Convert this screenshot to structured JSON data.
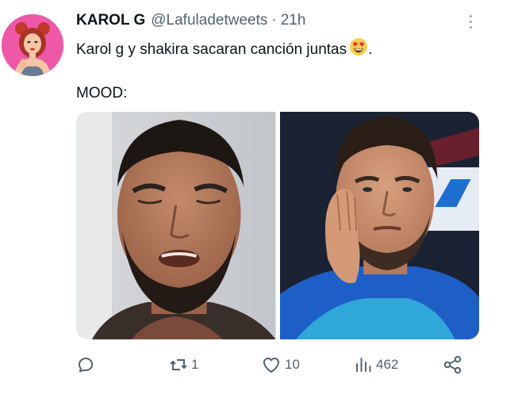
{
  "tweet": {
    "author_name": "KAROL G",
    "handle": "@Lafuladetweets",
    "separator": "·",
    "time": "21h",
    "text_line1": "Karol g y shakira sacaran canción juntas",
    "emoji": "smiling-face-with-heart-eyes",
    "text_line1_end": ".",
    "text_line2": "MOOD:"
  },
  "media": {
    "images": [
      {
        "name": "man-crying-face-photo"
      },
      {
        "name": "man-hand-on-cheek-photo"
      }
    ]
  },
  "actions": {
    "reply_count": "",
    "retweet_count": "1",
    "like_count": "10",
    "views_count": "462"
  },
  "colors": {
    "text": "#0f1419",
    "secondary": "#536471",
    "avatar_bg": "#ee58a7",
    "jersey_blue": "#1e5fc7"
  }
}
